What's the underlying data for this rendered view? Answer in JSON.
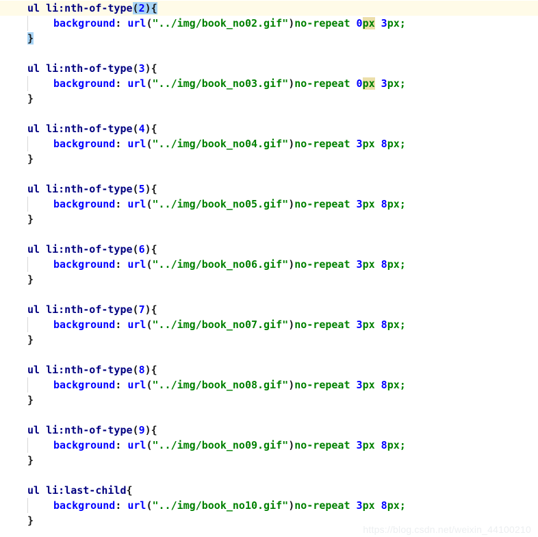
{
  "editor": {
    "language": "css",
    "font_weight": "bold",
    "colors": {
      "background": "#ffffff",
      "selector": "#000080",
      "property": "#0000ff",
      "string": "#008000",
      "number": "#0000ff",
      "punctuation": "#1a1a1a",
      "current_line_highlight": "#fffbe8",
      "bracket_match_highlight": "#a8d4f5",
      "token_occurrence_highlight": "#ecdfaa",
      "indent_guide": "#d8d8d8",
      "watermark": "#eceff1"
    },
    "indent_unit": "    "
  },
  "watermark": {
    "text": "https://blog.csdn.net/weixin_44100210"
  },
  "rules": [
    {
      "id": "rule-2",
      "selector_element": "ul",
      "selector_pseudo": "li:nth-of-type",
      "selector_arg_open": "(",
      "selector_arg": "2",
      "selector_arg_close": ")",
      "brace_open": "{",
      "brace_close": "}",
      "property": "background",
      "separator": ": ",
      "func": "url",
      "paren_open": "(",
      "url_value": "\"../img/book_no02.gif\"",
      "paren_close": ")",
      "repeat": "no-repeat",
      "pos_x_num": "0",
      "pos_x_unit": "px",
      "pos_y_num": "3",
      "pos_y_unit": "px",
      "semicolon": ";",
      "current_line": true,
      "bracket_matched": true,
      "unit_highlighted": true
    },
    {
      "id": "rule-3",
      "selector_element": "ul",
      "selector_pseudo": "li:nth-of-type",
      "selector_arg_open": "(",
      "selector_arg": "3",
      "selector_arg_close": ")",
      "brace_open": "{",
      "brace_close": "}",
      "property": "background",
      "separator": ": ",
      "func": "url",
      "paren_open": "(",
      "url_value": "\"../img/book_no03.gif\"",
      "paren_close": ")",
      "repeat": "no-repeat",
      "pos_x_num": "0",
      "pos_x_unit": "px",
      "pos_y_num": "3",
      "pos_y_unit": "px",
      "semicolon": ";",
      "current_line": false,
      "bracket_matched": false,
      "unit_highlighted": true
    },
    {
      "id": "rule-4",
      "selector_element": "ul",
      "selector_pseudo": "li:nth-of-type",
      "selector_arg_open": "(",
      "selector_arg": "4",
      "selector_arg_close": ")",
      "brace_open": "{",
      "brace_close": "}",
      "property": "background",
      "separator": ": ",
      "func": "url",
      "paren_open": "(",
      "url_value": "\"../img/book_no04.gif\"",
      "paren_close": ")",
      "repeat": "no-repeat",
      "pos_x_num": "3",
      "pos_x_unit": "px",
      "pos_y_num": "8",
      "pos_y_unit": "px",
      "semicolon": ";",
      "current_line": false,
      "bracket_matched": false,
      "unit_highlighted": false
    },
    {
      "id": "rule-5",
      "selector_element": "ul",
      "selector_pseudo": "li:nth-of-type",
      "selector_arg_open": "(",
      "selector_arg": "5",
      "selector_arg_close": ")",
      "brace_open": "{",
      "brace_close": "}",
      "property": "background",
      "separator": ": ",
      "func": "url",
      "paren_open": "(",
      "url_value": "\"../img/book_no05.gif\"",
      "paren_close": ")",
      "repeat": "no-repeat",
      "pos_x_num": "3",
      "pos_x_unit": "px",
      "pos_y_num": "8",
      "pos_y_unit": "px",
      "semicolon": ";",
      "current_line": false,
      "bracket_matched": false,
      "unit_highlighted": false
    },
    {
      "id": "rule-6",
      "selector_element": "ul",
      "selector_pseudo": "li:nth-of-type",
      "selector_arg_open": "(",
      "selector_arg": "6",
      "selector_arg_close": ")",
      "brace_open": "{",
      "brace_close": "}",
      "property": "background",
      "separator": ": ",
      "func": "url",
      "paren_open": "(",
      "url_value": "\"../img/book_no06.gif\"",
      "paren_close": ")",
      "repeat": "no-repeat",
      "pos_x_num": "3",
      "pos_x_unit": "px",
      "pos_y_num": "8",
      "pos_y_unit": "px",
      "semicolon": ";",
      "current_line": false,
      "bracket_matched": false,
      "unit_highlighted": false
    },
    {
      "id": "rule-7",
      "selector_element": "ul",
      "selector_pseudo": "li:nth-of-type",
      "selector_arg_open": "(",
      "selector_arg": "7",
      "selector_arg_close": ")",
      "brace_open": "{",
      "brace_close": "}",
      "property": "background",
      "separator": ": ",
      "func": "url",
      "paren_open": "(",
      "url_value": "\"../img/book_no07.gif\"",
      "paren_close": ")",
      "repeat": "no-repeat",
      "pos_x_num": "3",
      "pos_x_unit": "px",
      "pos_y_num": "8",
      "pos_y_unit": "px",
      "semicolon": ";",
      "current_line": false,
      "bracket_matched": false,
      "unit_highlighted": false
    },
    {
      "id": "rule-8",
      "selector_element": "ul",
      "selector_pseudo": "li:nth-of-type",
      "selector_arg_open": "(",
      "selector_arg": "8",
      "selector_arg_close": ")",
      "brace_open": "{",
      "brace_close": "}",
      "property": "background",
      "separator": ": ",
      "func": "url",
      "paren_open": "(",
      "url_value": "\"../img/book_no08.gif\"",
      "paren_close": ")",
      "repeat": "no-repeat",
      "pos_x_num": "3",
      "pos_x_unit": "px",
      "pos_y_num": "8",
      "pos_y_unit": "px",
      "semicolon": ";",
      "current_line": false,
      "bracket_matched": false,
      "unit_highlighted": false
    },
    {
      "id": "rule-9",
      "selector_element": "ul",
      "selector_pseudo": "li:nth-of-type",
      "selector_arg_open": "(",
      "selector_arg": "9",
      "selector_arg_close": ")",
      "brace_open": "{",
      "brace_close": "}",
      "property": "background",
      "separator": ": ",
      "func": "url",
      "paren_open": "(",
      "url_value": "\"../img/book_no09.gif\"",
      "paren_close": ")",
      "repeat": "no-repeat",
      "pos_x_num": "3",
      "pos_x_unit": "px",
      "pos_y_num": "8",
      "pos_y_unit": "px",
      "semicolon": ";",
      "current_line": false,
      "bracket_matched": false,
      "unit_highlighted": false
    },
    {
      "id": "rule-last",
      "selector_element": "ul",
      "selector_pseudo": "li:last-child",
      "selector_arg_open": "",
      "selector_arg": "",
      "selector_arg_close": "",
      "brace_open": "{",
      "brace_close": "}",
      "property": "background",
      "separator": ": ",
      "func": "url",
      "paren_open": "(",
      "url_value": "\"../img/book_no10.gif\"",
      "paren_close": ")",
      "repeat": "no-repeat",
      "pos_x_num": "3",
      "pos_x_unit": "px",
      "pos_y_num": "8",
      "pos_y_unit": "px",
      "semicolon": ";",
      "current_line": false,
      "bracket_matched": false,
      "unit_highlighted": false
    }
  ]
}
